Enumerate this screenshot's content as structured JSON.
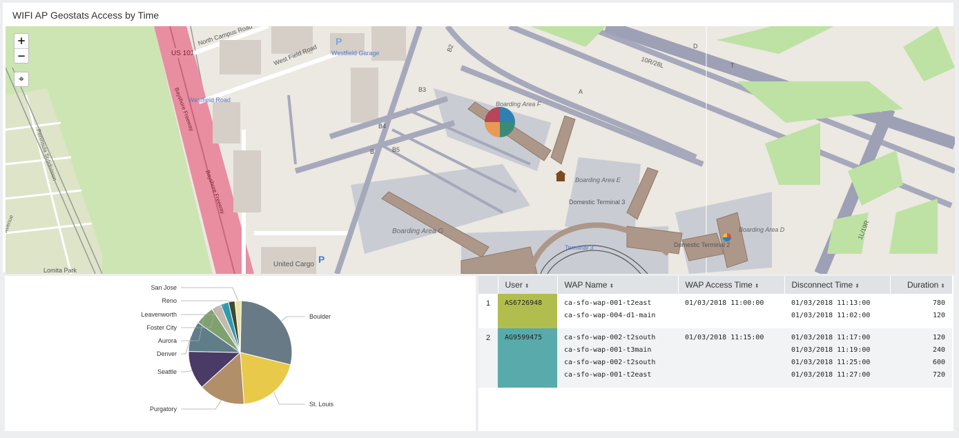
{
  "panel_title": "WIFI AP Geostats Access by Time",
  "map": {
    "zoom_in": "+",
    "zoom_out": "−",
    "locate": "⌖",
    "labels": {
      "north_campus_road": "North Campus Road",
      "west_field_road": "West Field Road",
      "westfield_road_sign": "Westfield Road",
      "westfield_garage": "Westfield Garage",
      "us101": "US 101",
      "bayshore1": "Bayshore Freeway",
      "bayshore2": "Bayshore Freeway",
      "boarding_f": "Boarding Area F",
      "boarding_e": "Boarding Area E",
      "boarding_g": "Boarding Area G",
      "boarding_d": "Boarding Area D",
      "domestic3": "Domestic Terminal 3",
      "domestic2": "Domestic Terminal 2",
      "terminal3": "Terminal 3",
      "united_cargo": "United Cargo",
      "lomita_park": "Lomita Park",
      "peninsula": "Peninsula Subdivision",
      "avenue": "Avenue",
      "taxi_b2": "B2",
      "taxi_b3": "B3",
      "taxi_b4": "B4",
      "taxi_b5": "B5",
      "taxi_b": "B",
      "taxi_a": "A",
      "taxi_d": "D",
      "taxi_t": "T",
      "runway1": "10R/28L",
      "runway2": "1L/19R",
      "parking": "P"
    }
  },
  "pie": {
    "labels": [
      "San Jose",
      "Reno",
      "Leavenworth",
      "Foster City",
      "Aurora",
      "Denver",
      "Seattle",
      "Purgatory",
      "St. Louis",
      "Boulder"
    ],
    "chart_data": {
      "type": "pie",
      "categories": [
        "Boulder",
        "St. Louis",
        "Purgatory",
        "Seattle",
        "Denver",
        "Aurora",
        "Foster City",
        "Leavenworth",
        "Reno",
        "San Jose"
      ],
      "values": [
        28.5,
        20,
        14.5,
        12,
        9.5,
        6,
        3,
        2.5,
        2,
        2
      ],
      "colors": [
        "#687a86",
        "#e8c94a",
        "#b08f69",
        "#4a3b66",
        "#5f7e8a",
        "#7fa16f",
        "#c4bab0",
        "#2e9bb0",
        "#3f4a34",
        "#e9e4a3"
      ]
    }
  },
  "table": {
    "headers": [
      "User",
      "WAP Name",
      "WAP Access Time",
      "Disconnect Time",
      "Duration"
    ],
    "sort_icon": "⬍",
    "rows": [
      {
        "index": "1",
        "user": "AS6726948",
        "wap_names": [
          "ca-sfo-wap-001-t2east",
          "ca-sfo-wap-004-d1-main"
        ],
        "access_time": "01/03/2018 11:00:00",
        "disconnect_times": [
          "01/03/2018 11:13:00",
          "01/03/2018 11:02:00"
        ],
        "durations": [
          "780",
          "120"
        ],
        "user_color": "#b1be4d"
      },
      {
        "index": "2",
        "user": "AG9599475",
        "wap_names": [
          "ca-sfo-wap-002-t2south",
          "ca-sfo-wap-001-t3main",
          "ca-sfo-wap-002-t2south",
          "ca-sfo-wap-001-t2east"
        ],
        "access_time": "01/03/2018 11:15:00",
        "disconnect_times": [
          "01/03/2018 11:17:00",
          "01/03/2018 11:19:00",
          "01/03/2018 11:25:00",
          "01/03/2018 11:27:00"
        ],
        "durations": [
          "120",
          "240",
          "600",
          "720"
        ],
        "user_color": "#59aaaa"
      }
    ]
  }
}
